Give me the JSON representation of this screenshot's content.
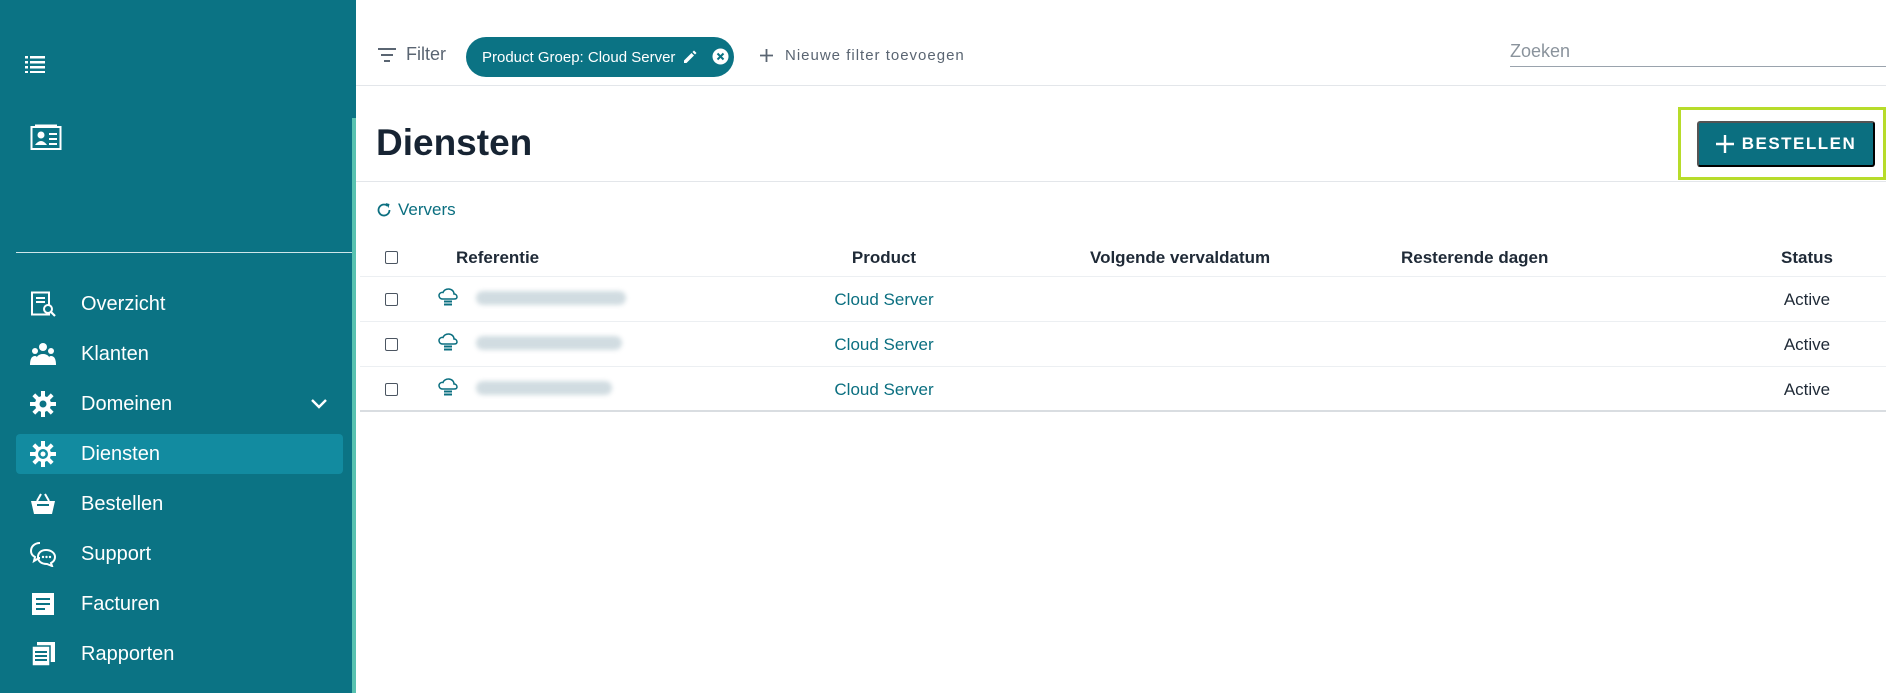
{
  "sidebar": {
    "top_icons": [
      "list-icon",
      "contact-card-icon"
    ],
    "items": [
      {
        "label": "Overzicht",
        "icon": "report-search-icon",
        "active": false
      },
      {
        "label": "Klanten",
        "icon": "users-icon",
        "active": false
      },
      {
        "label": "Domeinen",
        "icon": "gear-icon",
        "active": false,
        "expandable": true
      },
      {
        "label": "Diensten",
        "icon": "service-gear-icon",
        "active": true
      },
      {
        "label": "Bestellen",
        "icon": "basket-icon",
        "active": false
      },
      {
        "label": "Support",
        "icon": "chat-icon",
        "active": false
      },
      {
        "label": "Facturen",
        "icon": "invoice-icon",
        "active": false
      },
      {
        "label": "Rapporten",
        "icon": "reports-icon",
        "active": false
      }
    ]
  },
  "topbar": {
    "filter_label": "Filter",
    "active_filter": "Product Groep: Cloud Server",
    "add_filter_label": "Nieuwe filter toevoegen",
    "search_placeholder": "Zoeken"
  },
  "main": {
    "title": "Diensten",
    "order_button": "BESTELLEN",
    "refresh_label": "Ververs"
  },
  "table": {
    "columns": [
      "Referentie",
      "Product",
      "Volgende vervaldatum",
      "Resterende dagen",
      "Status"
    ],
    "rows": [
      {
        "product": "Cloud Server",
        "expires": "",
        "remaining": "",
        "status": "Active"
      },
      {
        "product": "Cloud Server",
        "expires": "",
        "remaining": "",
        "status": "Active"
      },
      {
        "product": "Cloud Server",
        "expires": "",
        "remaining": "",
        "status": "Active"
      }
    ]
  },
  "colors": {
    "sidebar": "#0b7384",
    "accent": "#0b6f80",
    "highlight": "#b7dc2a"
  }
}
